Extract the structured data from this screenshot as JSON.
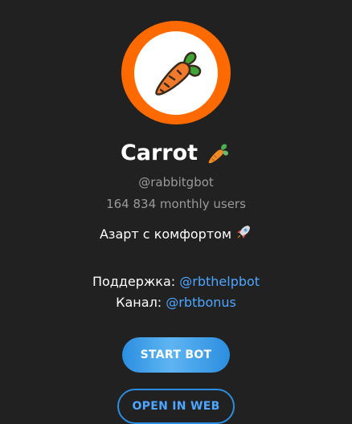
{
  "bot": {
    "name": "Carrot",
    "username": "@rabbitgbot",
    "monthly_users": "164 834 monthly users",
    "slogan": "Азарт с комфортом",
    "support_label": "Поддержка:",
    "support_link": "@rbthelpbot",
    "channel_label": "Канал:",
    "channel_link": "@rbtbonus"
  },
  "buttons": {
    "start": "START BOT",
    "open_web": "OPEN IN WEB"
  },
  "icons": {
    "avatar": "carrot-icon",
    "title_emoji": "carrot-emoji-icon",
    "slogan_emoji": "rocket-icon"
  },
  "colors": {
    "background": "#212121",
    "avatar_ring": "#ff6a00",
    "accent": "#4da6ff",
    "muted_text": "#9a9a9a"
  }
}
